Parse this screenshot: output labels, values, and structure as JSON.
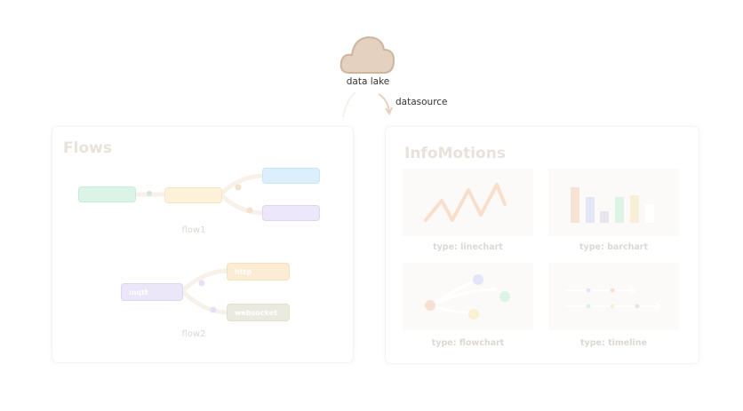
{
  "top": {
    "source_label": "data lake",
    "edge_label": "datasource"
  },
  "flows": {
    "title": "Flows",
    "flow1": {
      "label": "flow1"
    },
    "flow2": {
      "label": "flow2",
      "nodes": [
        "mqtt",
        "http",
        "websocket"
      ]
    }
  },
  "infomotions": {
    "title": "InfoMotions",
    "cards": [
      {
        "label": "type: linechart"
      },
      {
        "label": "type: barchart"
      },
      {
        "label": "type: flowchart"
      },
      {
        "label": "type: timeline"
      }
    ]
  },
  "colors": {
    "cloud": "#e5d1bf",
    "cloud_stroke": "#cdb59e",
    "text": "#333333"
  }
}
